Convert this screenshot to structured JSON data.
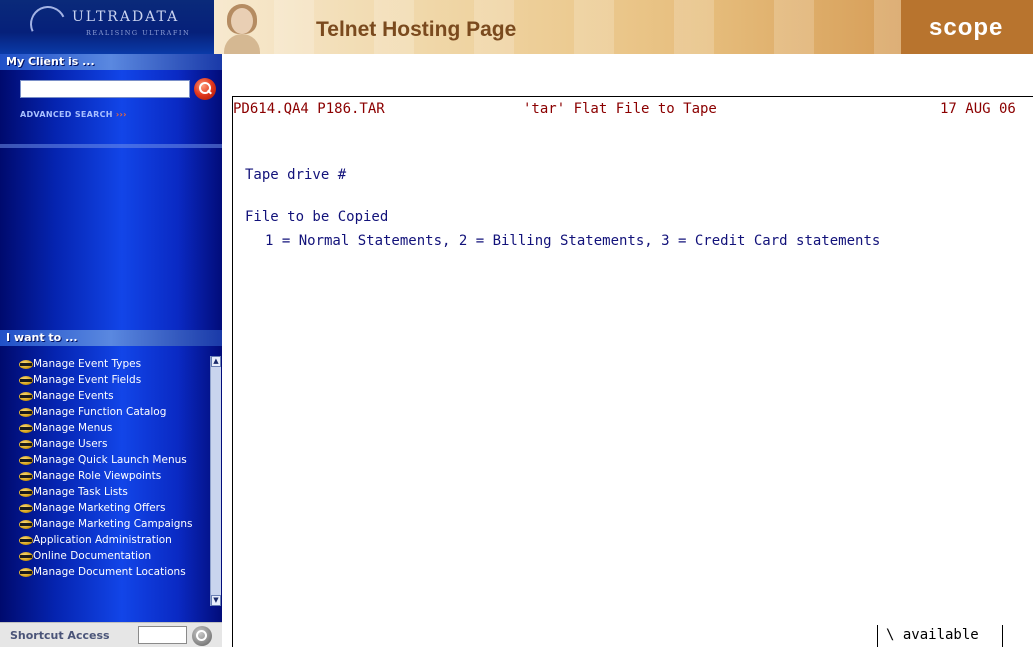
{
  "header": {
    "logo_text": "ULTRADATA",
    "logo_tagline": "REALISING ULTRAFIN",
    "title": "Telnet Hosting Page",
    "brand": "scope"
  },
  "sidebar": {
    "client_header": "My Client is ...",
    "client_input_value": "",
    "advanced_search_label": "ADVANCED SEARCH",
    "advanced_search_arrows": "›››",
    "tasks_header": "I want to ...",
    "tasks": [
      {
        "label": "Manage Event Types"
      },
      {
        "label": "Manage Event Fields"
      },
      {
        "label": "Manage Events"
      },
      {
        "label": "Manage Function Catalog"
      },
      {
        "label": "Manage Menus"
      },
      {
        "label": "Manage Users"
      },
      {
        "label": "Manage Quick Launch Menus"
      },
      {
        "label": "Manage Role Viewpoints"
      },
      {
        "label": "Manage Task Lists"
      },
      {
        "label": "Manage Marketing Offers"
      },
      {
        "label": "Manage Marketing Campaigns"
      },
      {
        "label": "Application Administration"
      },
      {
        "label": "Online Documentation"
      },
      {
        "label": "Manage Document Locations"
      }
    ],
    "shortcut_label": "Shortcut Access",
    "shortcut_input_value": ""
  },
  "terminal": {
    "program": "PD614.QA4 P186.TAR",
    "screen_title": "'tar' Flat File to Tape",
    "date": "17 AUG 06",
    "prompt_tape": "Tape drive #",
    "prompt_file": "File to be Copied",
    "file_options": "1 = Normal Statements, 2 = Billing Statements, 3 = Credit Card statements",
    "status": "\\ available"
  },
  "colors": {
    "sidebar_blue": "#0524b0",
    "terminal_header": "#8b0000",
    "terminal_text": "#12127a",
    "banner_title": "#7a4a1e",
    "brand_bg": "#b8742e"
  },
  "icons": {
    "search": "search-icon",
    "task": "task-arrow-icon",
    "shortcut_go": "go-icon"
  }
}
